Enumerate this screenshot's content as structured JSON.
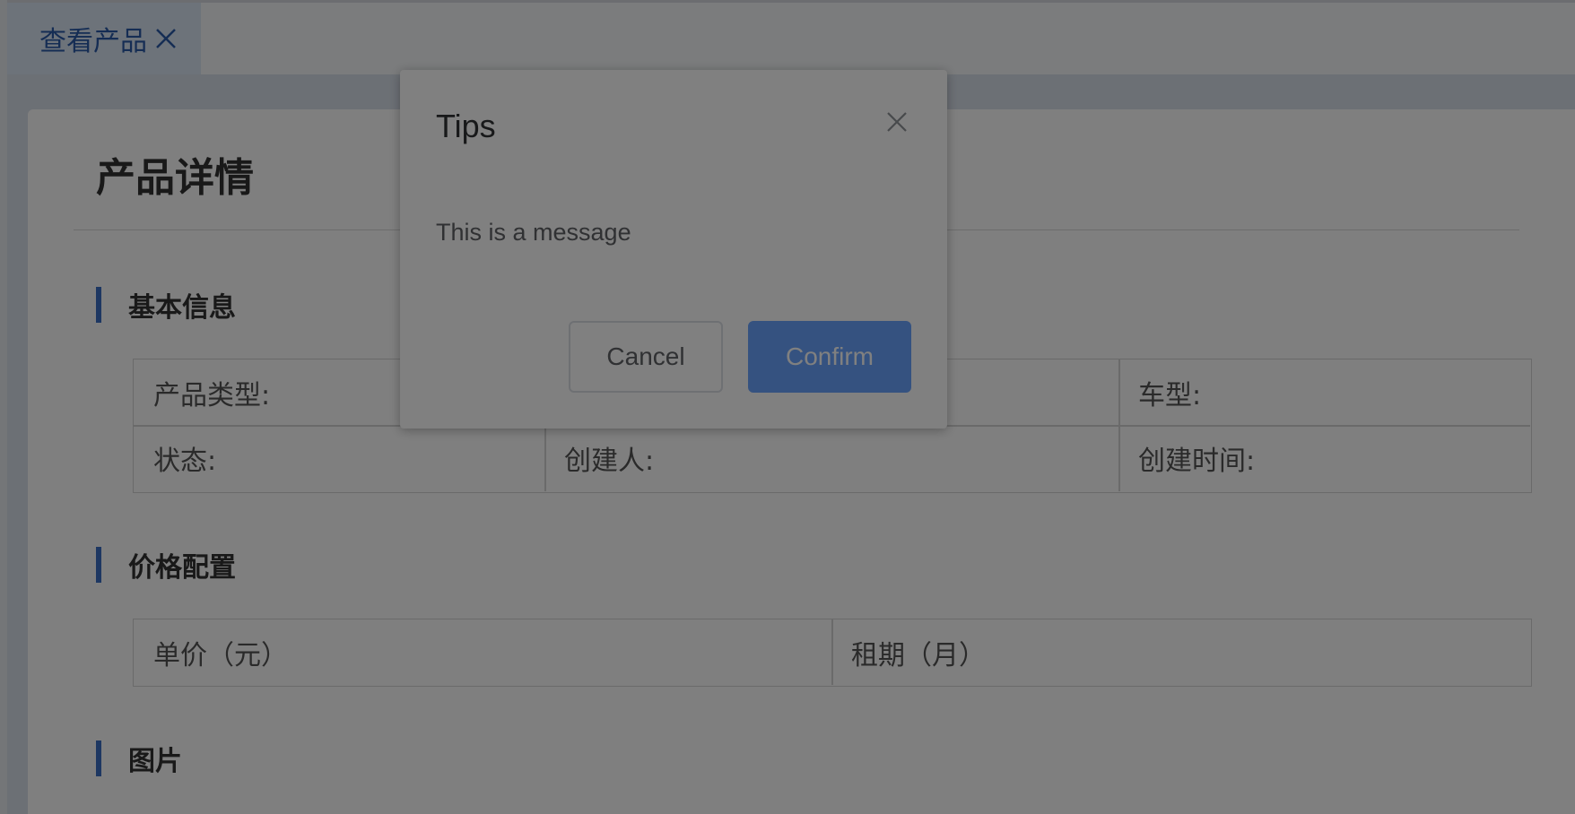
{
  "tab": {
    "label": "查看产品",
    "close_icon": "close-icon"
  },
  "page": {
    "title": "产品详情"
  },
  "sections": {
    "basic": {
      "title": "基本信息",
      "fields": {
        "product_type": "产品类型:",
        "car_model": "车型:",
        "status": "状态:",
        "creator": "创建人:",
        "created_time": "创建时间:"
      }
    },
    "price": {
      "title": "价格配置",
      "fields": {
        "unit_price": "单价（元）",
        "lease_term": "租期（月）"
      }
    },
    "images": {
      "title": "图片"
    }
  },
  "dialog": {
    "title": "Tips",
    "message": "This is a message",
    "cancel_label": "Cancel",
    "confirm_label": "Confirm",
    "close_icon": "close-icon"
  },
  "colors": {
    "accent": "#3a6fc4",
    "confirm": "#6aa4ff",
    "tab_bg": "#dbe6f5",
    "overlay": "rgba(0,0,0,0.5)"
  }
}
